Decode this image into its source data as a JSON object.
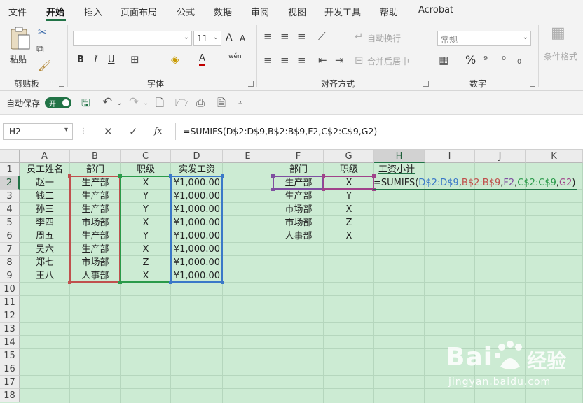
{
  "menu": [
    "文件",
    "开始",
    "插入",
    "页面布局",
    "公式",
    "数据",
    "审阅",
    "视图",
    "开发工具",
    "帮助",
    "Acrobat"
  ],
  "ribbon": {
    "clipboard": {
      "paste": "粘贴",
      "label": "剪贴板"
    },
    "font": {
      "label": "字体",
      "font_size": "11",
      "bold": "B",
      "italic": "I",
      "underline": "U",
      "grow": "A",
      "shrink": "A",
      "wen": "wén"
    },
    "alignment": {
      "label": "对齐方式",
      "wrap": "自动换行",
      "merge": "合并后居中"
    },
    "number": {
      "label": "数字",
      "format": "常规",
      "percent": "%"
    },
    "styles": {
      "conditional": "条件格式"
    }
  },
  "qat": {
    "autosave": "自动保存",
    "toggle": "开"
  },
  "formula_bar": {
    "name_box": "H2",
    "fx": "fx",
    "formula": "=SUMIFS(D$2:D$9,B$2:B$9,F2,C$2:C$9,G2)"
  },
  "columns": [
    "A",
    "B",
    "C",
    "D",
    "E",
    "F",
    "G",
    "H",
    "I",
    "J",
    "K"
  ],
  "rows": [
    "1",
    "2",
    "3",
    "4",
    "5",
    "6",
    "7",
    "8",
    "9",
    "10",
    "11",
    "12",
    "13",
    "14",
    "15",
    "16",
    "17",
    "18"
  ],
  "table1": {
    "headers": [
      "员工姓名",
      "部门",
      "职级",
      "实发工资"
    ],
    "rows": [
      [
        "赵一",
        "生产部",
        "X",
        "¥1,000.00"
      ],
      [
        "钱二",
        "生产部",
        "Y",
        "¥1,000.00"
      ],
      [
        "孙三",
        "生产部",
        "Y",
        "¥1,000.00"
      ],
      [
        "李四",
        "市场部",
        "X",
        "¥1,000.00"
      ],
      [
        "周五",
        "生产部",
        "Y",
        "¥1,000.00"
      ],
      [
        "吴六",
        "生产部",
        "X",
        "¥1,000.00"
      ],
      [
        "郑七",
        "市场部",
        "Z",
        "¥1,000.00"
      ],
      [
        "王八",
        "人事部",
        "X",
        "¥1,000.00"
      ]
    ]
  },
  "table2": {
    "headers": [
      "部门",
      "职级",
      "工资小计"
    ],
    "rows": [
      [
        "生产部",
        "X"
      ],
      [
        "生产部",
        "Y"
      ],
      [
        "市场部",
        "X"
      ],
      [
        "市场部",
        "Z"
      ],
      [
        "人事部",
        "X"
      ]
    ]
  },
  "edit": {
    "p1": "=SUMIFS(",
    "p2": "D$2:D$9",
    "p3": ",",
    "p4": "B$2:B$9",
    "p5": ",",
    "p6": "F2",
    "p7": ",",
    "p8": "C$2:C$9",
    "p9": ",",
    "p10": "G2",
    "p11": ")"
  },
  "watermark": {
    "brand": "Bai",
    "brand2": "经验",
    "url": "jingyan.baidu.com"
  },
  "colors": {
    "accent": "#217346",
    "ref_d": "#3a78c8",
    "ref_b": "#c0504d",
    "ref_f": "#7f4fa0",
    "ref_c": "#2a9a4a",
    "ref_g": "#a0438a"
  }
}
